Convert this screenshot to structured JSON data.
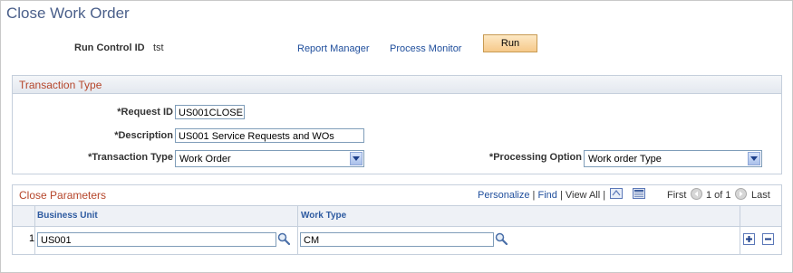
{
  "page": {
    "title": "Close Work Order",
    "run_control_label": "Run Control ID",
    "run_control_value": "tst",
    "report_manager": "Report Manager",
    "process_monitor": "Process Monitor",
    "run_button": "Run"
  },
  "transaction_section": {
    "title": "Transaction Type",
    "request_id_label": "*Request ID",
    "request_id_value": "US001CLOSE",
    "description_label": "*Description",
    "description_value": "US001 Service Requests and WOs",
    "transaction_type_label": "*Transaction Type",
    "transaction_type_value": "Work Order",
    "processing_option_label": "*Processing Option",
    "processing_option_value": "Work order Type"
  },
  "close_parameters": {
    "title": "Close Parameters",
    "personalize": "Personalize",
    "sep": "|",
    "find": "Find",
    "view_all": "View All",
    "first": "First",
    "pager": "1 of 1",
    "last": "Last",
    "columns": [
      "Business Unit",
      "Work Type"
    ],
    "rows": [
      {
        "num": "1",
        "business_unit": "US001",
        "work_type": "CM"
      }
    ]
  },
  "colors": {
    "title": "#4a5f8a",
    "section_title": "#b5452a",
    "link": "#1f4e9c",
    "column_header": "#2d5aa0",
    "run_button": "#f6c98a"
  },
  "icons": [
    "search-icon",
    "add-row-icon",
    "delete-row-icon",
    "download-icon",
    "grid-view-icon",
    "prev-arrow-icon",
    "next-arrow-icon",
    "dropdown-arrow-icon"
  ]
}
